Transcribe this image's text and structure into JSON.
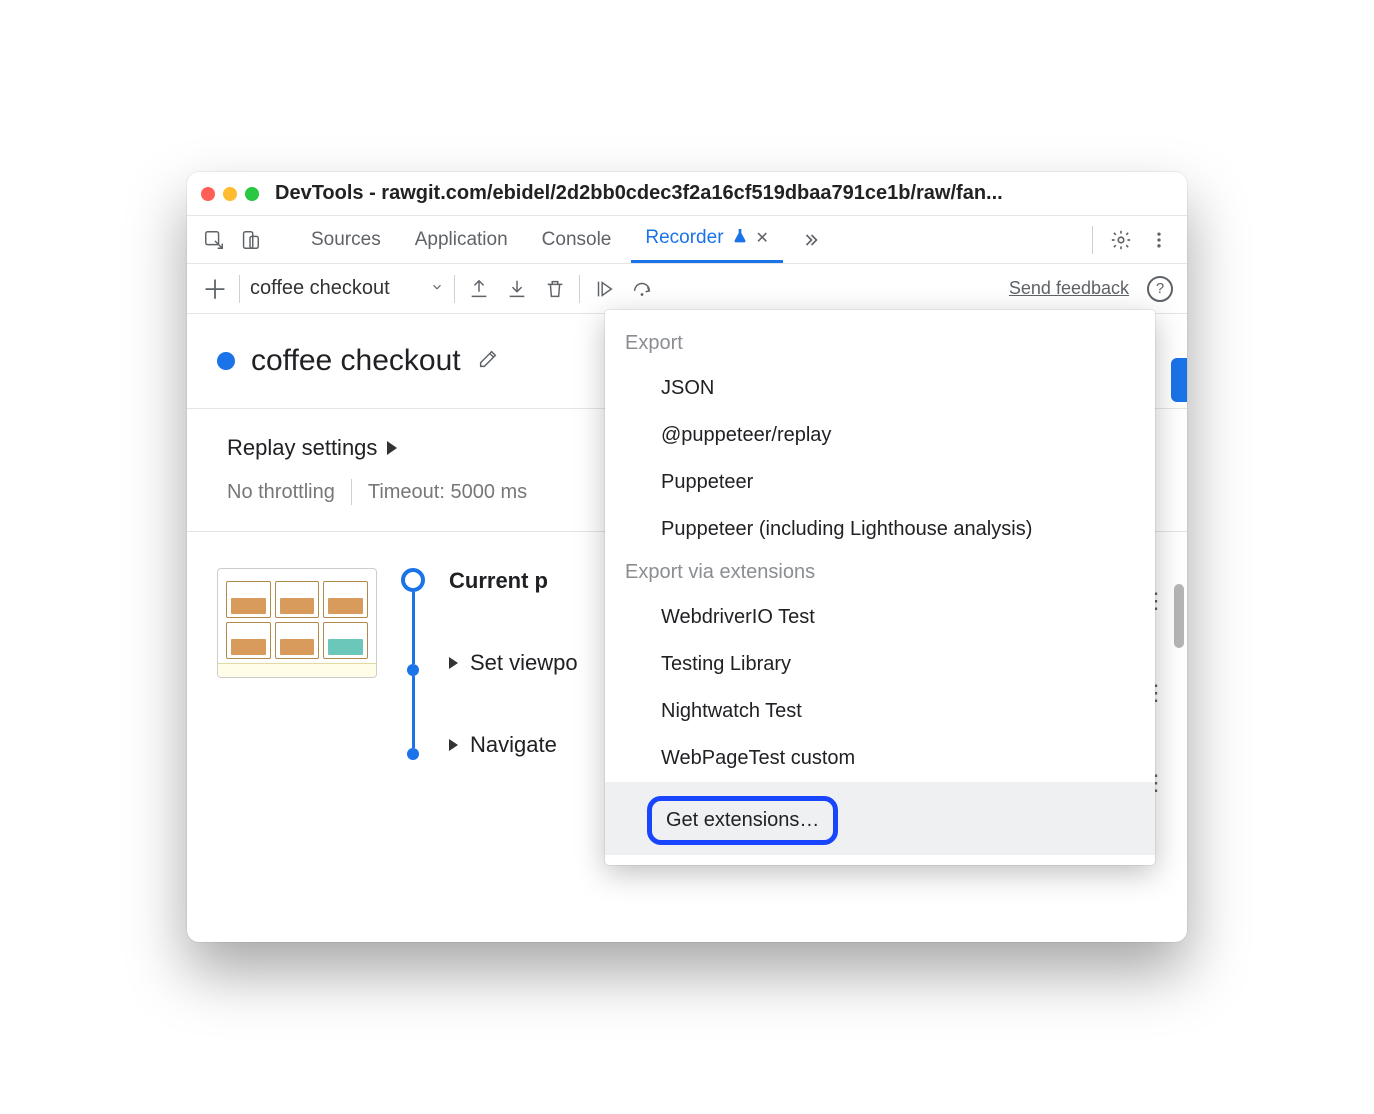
{
  "window": {
    "title": "DevTools - rawgit.com/ebidel/2d2bb0cdec3f2a16cf519dbaa791ce1b/raw/fan..."
  },
  "tabs": {
    "sources": "Sources",
    "application": "Application",
    "console": "Console",
    "recorder": "Recorder"
  },
  "toolbar": {
    "recording_name": "coffee checkout",
    "feedback": "Send feedback"
  },
  "recording": {
    "name": "coffee checkout"
  },
  "replay": {
    "heading": "Replay settings",
    "throttling": "No throttling",
    "timeout": "Timeout: 5000 ms"
  },
  "steps": {
    "current": "Current p",
    "set_viewport": "Set viewpo",
    "navigate": "Navigate"
  },
  "export": {
    "header1": "Export",
    "items1": [
      "JSON",
      "@puppeteer/replay",
      "Puppeteer",
      "Puppeteer (including Lighthouse analysis)"
    ],
    "header2": "Export via extensions",
    "items2": [
      "WebdriverIO Test",
      "Testing Library",
      "Nightwatch Test",
      "WebPageTest custom"
    ],
    "get_extensions": "Get extensions…"
  }
}
